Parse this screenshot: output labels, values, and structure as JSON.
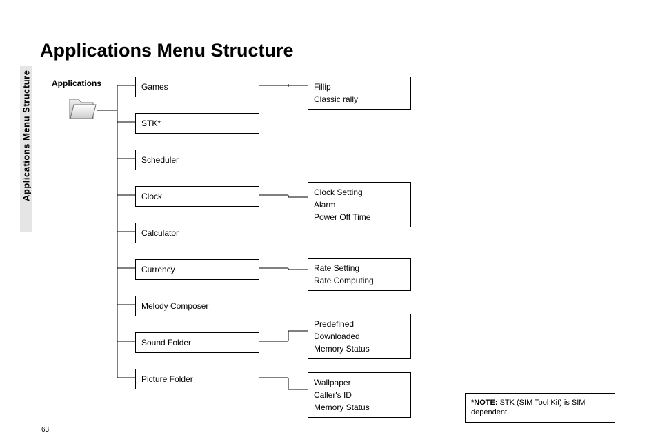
{
  "side_tab": "Applications Menu Structure",
  "title": "Applications Menu Structure",
  "root_label": "Applications",
  "col1": {
    "games": "Games",
    "stk": "STK*",
    "scheduler": "Scheduler",
    "clock": "Clock",
    "calculator": "Calculator",
    "currency": "Currency",
    "melody": "Melody Composer",
    "sound": "Sound Folder",
    "picture": "Picture Folder"
  },
  "col2": {
    "games": {
      "l1": "Fillip",
      "l2": "Classic rally"
    },
    "clock": {
      "l1": "Clock Setting",
      "l2": "Alarm",
      "l3": "Power Off Time"
    },
    "currency": {
      "l1": "Rate Setting",
      "l2": "Rate Computing"
    },
    "sound": {
      "l1": "Predefined",
      "l2": "Downloaded",
      "l3": "Memory Status"
    },
    "picture": {
      "l1": "Wallpaper",
      "l2": "Caller's ID",
      "l3": "Memory Status"
    }
  },
  "note": {
    "prefix": "*NOTE: ",
    "text": "STK (SIM Tool Kit) is SIM dependent."
  },
  "page_number": "63"
}
